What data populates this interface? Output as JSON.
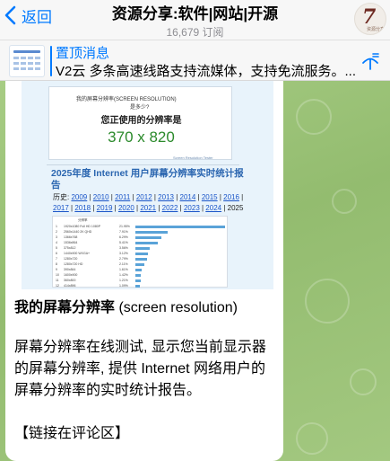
{
  "header": {
    "back_label": "返回",
    "title": "资源分享:软件|网站|开源",
    "subscribers": "16,679 订阅",
    "avatar_glyph": "7",
    "avatar_caption": "资源分享"
  },
  "pinned": {
    "title": "置顶消息",
    "text": "V2云 多条高速线路支持流媒体，支持免流服务。..."
  },
  "message": {
    "screenshot": {
      "heading_line1": "我的屏幕分辨率(SCREEN RESOLUTION)",
      "heading_line2": "是多少?",
      "question": "您正使用的分辨率是",
      "resolution": "370 x 820",
      "link_text": "Screen Resolution Tester",
      "report_title": "2025年度 Internet 用户屏幕分辨率实时统计报告",
      "history_label": "历史:",
      "years": [
        "2009",
        "2010",
        "2011",
        "2012",
        "2013",
        "2014",
        "2015",
        "2016",
        "2017",
        "2018",
        "2019",
        "2020",
        "2021",
        "2022",
        "2023",
        "2024"
      ],
      "current_year": "2025",
      "table_header": "分辨率",
      "table_rows": [
        {
          "rank": "1",
          "res": "1920x1080 Full HD 1080P",
          "pct": "21.95%",
          "share": 21.95
        },
        {
          "rank": "2",
          "res": "2560x1440 2K QHD",
          "pct": "7.91%",
          "share": 7.91
        },
        {
          "rank": "3",
          "res": "1366x768",
          "pct": "6.29%",
          "share": 6.29
        },
        {
          "rank": "4",
          "res": "1536x864",
          "pct": "5.41%",
          "share": 5.41
        },
        {
          "rank": "5",
          "res": "375x812",
          "pct": "3.56%",
          "share": 3.56
        },
        {
          "rank": "6",
          "res": "1440x900 WXGA+",
          "pct": "3.12%",
          "share": 3.12
        },
        {
          "rank": "7",
          "res": "1280x720",
          "pct": "2.79%",
          "share": 2.79
        },
        {
          "rank": "8",
          "res": "1280x720 HD",
          "pct": "2.11%",
          "share": 2.11
        },
        {
          "rank": "9",
          "res": "390x844",
          "pct": "1.61%",
          "share": 1.61
        },
        {
          "rank": "10",
          "res": "1600x900",
          "pct": "1.42%",
          "share": 1.42
        },
        {
          "rank": "11",
          "res": "360x800",
          "pct": "1.21%",
          "share": 1.21
        },
        {
          "rank": "12",
          "res": "414x896",
          "pct": "1.09%",
          "share": 1.09
        }
      ]
    },
    "title_bold": "我的屏幕分辨率",
    "title_rest": " (screen resolution)",
    "body": "屏幕分辨率在线测试, 显示您当前显示器的屏幕分辨率, 提供 Internet 网络用户的屏幕分辨率的实时统计报告。",
    "note": "【链接在评论区】"
  },
  "colors": {
    "accent": "#007aff",
    "chat_bg": "#9cc37a",
    "report_blue": "#2b66b0",
    "resolution_green": "#2b8a2b"
  }
}
